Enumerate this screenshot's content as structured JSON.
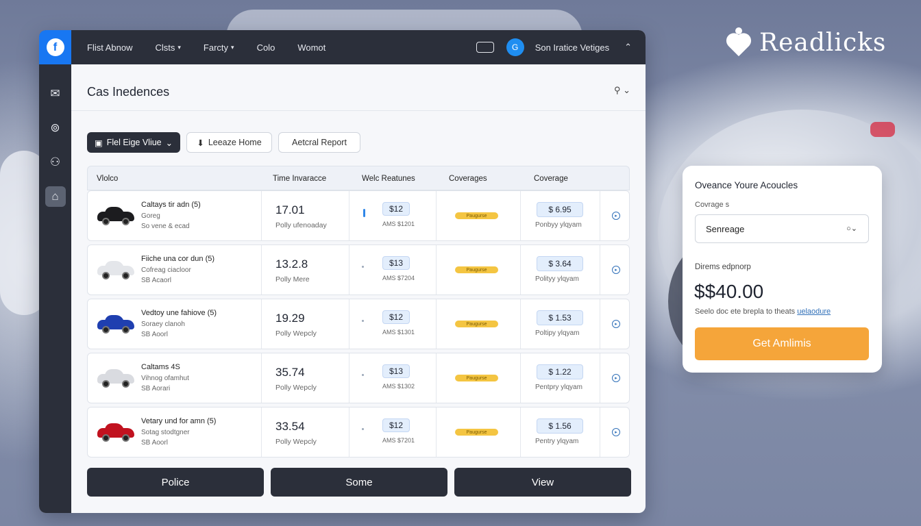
{
  "brand": {
    "name": "Readlicks"
  },
  "topbar": {
    "logo": "f",
    "nav": [
      {
        "label": "Flist Abnow",
        "chevron": false
      },
      {
        "label": "Clsts",
        "chevron": true
      },
      {
        "label": "Farcty",
        "chevron": true
      },
      {
        "label": "Colo",
        "chevron": false
      },
      {
        "label": "Womot",
        "chevron": false
      }
    ],
    "avatar": "G",
    "user_name": "Son Iratice Vetiges"
  },
  "sidebar": {
    "icons": [
      "mail-icon",
      "bag-icon",
      "users-icon",
      "lock-icon"
    ],
    "active_index": 3
  },
  "main": {
    "title": "Cas Inedences",
    "buttons": {
      "primary": "Flel Eige Vliue",
      "secondary": "Leeaze Home",
      "tertiary": "Aetcral Report"
    },
    "table": {
      "headers": [
        "Vlolco",
        "Time Invaracce",
        "Welc Reatunes",
        "Coverages",
        "Coverage"
      ],
      "rows": [
        {
          "name": "Caltays tir adn",
          "tag": "(5)",
          "sub1": "Goreg",
          "sub2": "So vene & ecad",
          "big": "17.01",
          "small": "Polly ufenoaday",
          "pill": "$12",
          "psub": "AMS $1201",
          "badge": "Paugurse",
          "coverage": "$ 6.95",
          "csub": "Ponbyy ylqyam",
          "car_color": "#1c1c1f",
          "bar": true
        },
        {
          "name": "Fiiche una cor dun",
          "tag": "(5)",
          "sub1": "Cofreag ciacloor",
          "sub2": "SB Acaorl",
          "big": "13.2.8",
          "small": "Polly Mere",
          "pill": "$13",
          "psub": "AMS $7204",
          "badge": "Paugurse",
          "coverage": "$ 3.64",
          "csub": "Polityy ylqyam",
          "car_color": "#e4e6ea",
          "bar": false
        },
        {
          "name": "Vedtoy une fahiove",
          "tag": "(5)",
          "sub1": "Soraey clanoh",
          "sub2": "SB Aoorl",
          "big": "19.29",
          "small": "Polly Wepcly",
          "pill": "$12",
          "psub": "AMS $1301",
          "badge": "Paugurse",
          "coverage": "$ 1.53",
          "csub": "Poltipy ylqyam",
          "car_color": "#1f3fb0",
          "bar": false
        },
        {
          "name": "Caltams 4S",
          "tag": "",
          "sub1": "Vihnog ofamhut",
          "sub2": "SB Aorari",
          "big": "35.74",
          "small": "Polly Wepcly",
          "pill": "$13",
          "psub": "AMS $1302",
          "badge": "Paugurse",
          "coverage": "$ 1.22",
          "csub": "Pentpry ylqyam",
          "car_color": "#d9dbe0",
          "bar": false
        },
        {
          "name": "Vetary und for amn",
          "tag": "(5)",
          "sub1": "Sotag stodtgner",
          "sub2": "SB Aoorl",
          "big": "33.54",
          "small": "Polly Wepcly",
          "pill": "$12",
          "psub": "AMS $7201",
          "badge": "Paugurse",
          "coverage": "$ 1.56",
          "csub": "Pentry ylqyam",
          "car_color": "#c1121f",
          "bar": false
        }
      ]
    },
    "actions": [
      "Police",
      "Some",
      "View"
    ]
  },
  "panel": {
    "title": "Oveance Youre Acoucles",
    "coverage_label": "Covrage s",
    "select_value": "Senreage",
    "select_marker": "○⌄",
    "price_label": "Direms edpnorp",
    "price": "$$40.00",
    "note": "Seelo doc ete brepla to theats",
    "note_link": "uelaodure",
    "cta": "Get Amlimis"
  },
  "colors": {
    "topbar": "#2b2f3a",
    "accent": "#1877f2",
    "cta": "#f5a53a",
    "badge": "#f4c542"
  }
}
